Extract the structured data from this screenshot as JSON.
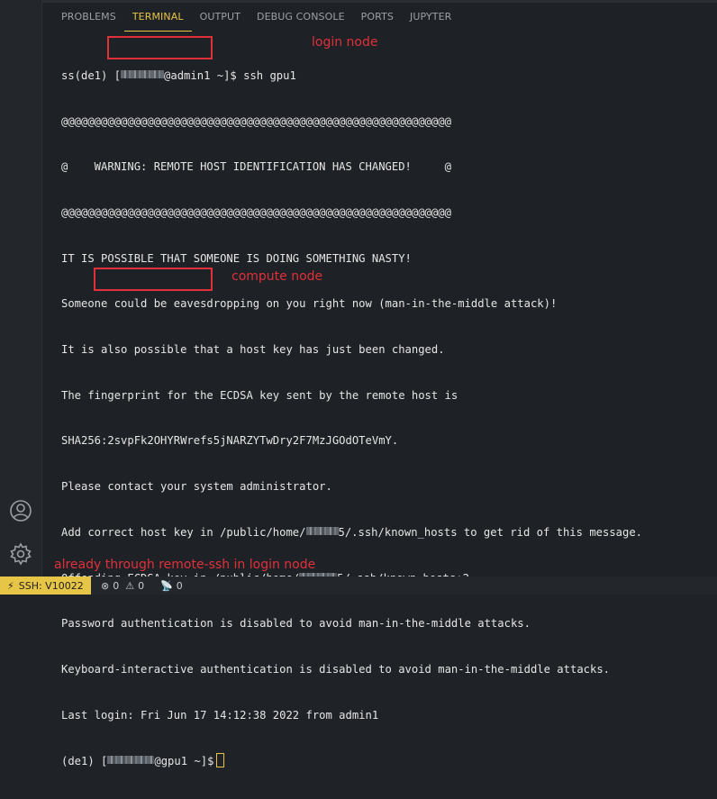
{
  "tabs": [
    "PROBLEMS",
    "TERMINAL",
    "OUTPUT",
    "DEBUG CONSOLE",
    "PORTS",
    "JUPYTER"
  ],
  "terminal": {
    "line1": {
      "prefix": "ss(de1) [",
      "host": "@admin1",
      "suffix": " ~]$ ssh gpu1"
    },
    "warn_border": "@@@@@@@@@@@@@@@@@@@@@@@@@@@@@@@@@@@@@@@@@@@@@@@@@@@@@@@@@@@",
    "warn_msg": "@    WARNING: REMOTE HOST IDENTIFICATION HAS CHANGED!     @",
    "l4": "IT IS POSSIBLE THAT SOMEONE IS DOING SOMETHING NASTY!",
    "l5": "Someone could be eavesdropping on you right now (man-in-the-middle attack)!",
    "l6": "It is also possible that a host key has just been changed.",
    "l7": "The fingerprint for the ECDSA key sent by the remote host is",
    "l8": "SHA256:2svpFk2OHYRWrefs5jNARZYTwDry2F7MzJGOdOTeVmY.",
    "l9": "Please contact your system administrator.",
    "l10": {
      "a": "Add correct host key in /public/home/",
      "b": "5/.ssh/known_hosts to get rid of this message."
    },
    "l11": {
      "a": "Offending ECDSA key in /public/home/",
      "b": "5/.ssh/known_hosts:2"
    },
    "l12": "Password authentication is disabled to avoid man-in-the-middle attacks.",
    "l13": "Keyboard-interactive authentication is disabled to avoid man-in-the-middle attacks.",
    "l14": "Last login: Fri Jun 17 14:12:38 2022 from admin1",
    "l15": {
      "prefix": "(de1) [",
      "host": "@gpu1 ~]$"
    }
  },
  "annotations": {
    "login_node": "login node",
    "compute_node": "compute node",
    "footer": "already through remote-ssh in login node"
  },
  "status": {
    "remote": "SSH: V10022",
    "errors": "0",
    "warnings": "0",
    "ports": "0"
  },
  "icons": {
    "account": "account-icon",
    "settings": "gear-icon",
    "remote": "remote-icon"
  },
  "colors": {
    "accent": "#e7c547",
    "annotation": "#e0313b"
  }
}
